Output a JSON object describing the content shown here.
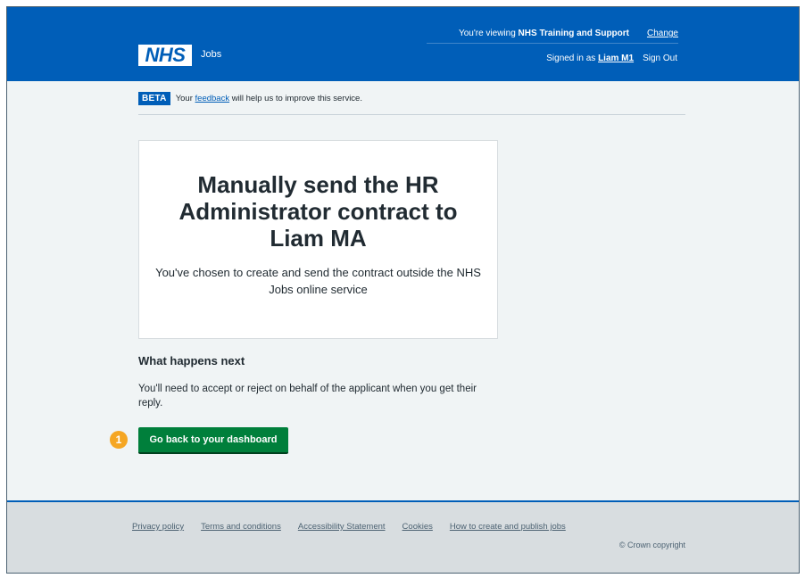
{
  "header": {
    "viewing_prefix": "You're viewing ",
    "viewing_org": "NHS Training and Support",
    "change_label": "Change",
    "logo_text": "NHS",
    "service_name": "Jobs",
    "signed_in_prefix": "Signed in as",
    "user_name": "Liam M1",
    "sign_out_label": "Sign Out"
  },
  "beta": {
    "tag": "BETA",
    "text_before": "Your",
    "link": "feedback",
    "text_after": "will help us to improve this service."
  },
  "panel": {
    "title": "Manually send the HR Administrator contract to Liam MA",
    "body": "You've chosen to create and send the contract outside the NHS Jobs online service"
  },
  "next": {
    "heading": "What happens next",
    "body": "You'll need to accept or reject on behalf of the applicant when you get their reply."
  },
  "annotation": {
    "number": "1"
  },
  "button": {
    "label": "Go back to your dashboard"
  },
  "footer": {
    "links": [
      "Privacy policy",
      "Terms and conditions",
      "Accessibility Statement",
      "Cookies",
      "How to create and publish jobs"
    ],
    "copyright": "© Crown copyright"
  },
  "colors": {
    "brand_blue": "#005eb8",
    "button_green": "#007f3b",
    "badge_orange": "#f5a623",
    "page_bg": "#f0f4f5"
  }
}
